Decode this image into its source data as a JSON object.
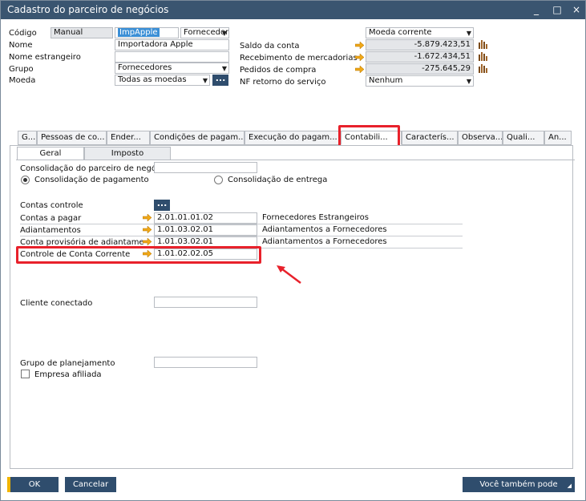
{
  "window": {
    "title": "Cadastro do parceiro de negócios",
    "controls": [
      "_",
      "□",
      "×"
    ]
  },
  "header": {
    "codigo_label": "Código",
    "codigo_series": "Manual",
    "codigo_value": "ImpApple",
    "type_value": "Fornecedor",
    "nome_label": "Nome",
    "nome_value": "Importadora Apple",
    "nome_estrangeiro_label": "Nome estrangeiro",
    "nome_estrangeiro_value": "",
    "grupo_label": "Grupo",
    "grupo_value": "Fornecedores",
    "moeda_label": "Moeda",
    "moeda_value": "Todas as moedas",
    "currency_select": "Moeda corrente",
    "saldo_label": "Saldo da conta",
    "saldo_value": "-5.879.423,51",
    "recebimento_label": "Recebimento de mercadorias",
    "recebimento_value": "-1.672.434,51",
    "pedidos_label": "Pedidos de compra",
    "pedidos_value": "-275.645,29",
    "nf_label": "NF retorno do serviço",
    "nf_value": "Nenhum"
  },
  "tabs": [
    {
      "label": "G..."
    },
    {
      "label": "Pessoas de co..."
    },
    {
      "label": "Ender..."
    },
    {
      "label": "Condições de pagam..."
    },
    {
      "label": "Execução do pagam..."
    },
    {
      "label": "Contabili..."
    },
    {
      "label": "Caracterís..."
    },
    {
      "label": "Observa..."
    },
    {
      "label": "Quali..."
    },
    {
      "label": "An..."
    }
  ],
  "subtabs": [
    {
      "label": "Geral"
    },
    {
      "label": "Imposto"
    }
  ],
  "contabilidade": {
    "consolidacao_label": "Consolidação do parceiro de negó",
    "consolidacao_value": "",
    "radio_pagamento": "Consolidação de pagamento",
    "radio_entrega": "Consolidação de entrega",
    "contas_controle_label": "Contas controle",
    "rows": [
      {
        "label": "Contas a pagar",
        "code": "2.01.01.01.02",
        "desc": "Fornecedores Estrangeiros"
      },
      {
        "label": "Adiantamentos",
        "code": "1.01.03.02.01",
        "desc": "Adiantamentos a Fornecedores"
      },
      {
        "label": "Conta provisória de adiantamento",
        "code": "1.01.03.02.01",
        "desc": "Adiantamentos a Fornecedores"
      },
      {
        "label": "Controle de Conta Corrente",
        "code": "1.01.02.02.05",
        "desc": ""
      }
    ],
    "cliente_conectado_label": "Cliente conectado",
    "cliente_conectado_value": "",
    "grupo_planejamento_label": "Grupo de planejamento",
    "grupo_planejamento_value": "",
    "empresa_afiliada_label": "Empresa afiliada"
  },
  "footer": {
    "ok_label": "OK",
    "cancel_label": "Cancelar",
    "more_label": "Você também pode"
  },
  "colors": {
    "titlebar": "#3a5570",
    "button": "#2f4d6d",
    "highlight_box": "#e8212b",
    "link_arrow": "#f0a818"
  }
}
